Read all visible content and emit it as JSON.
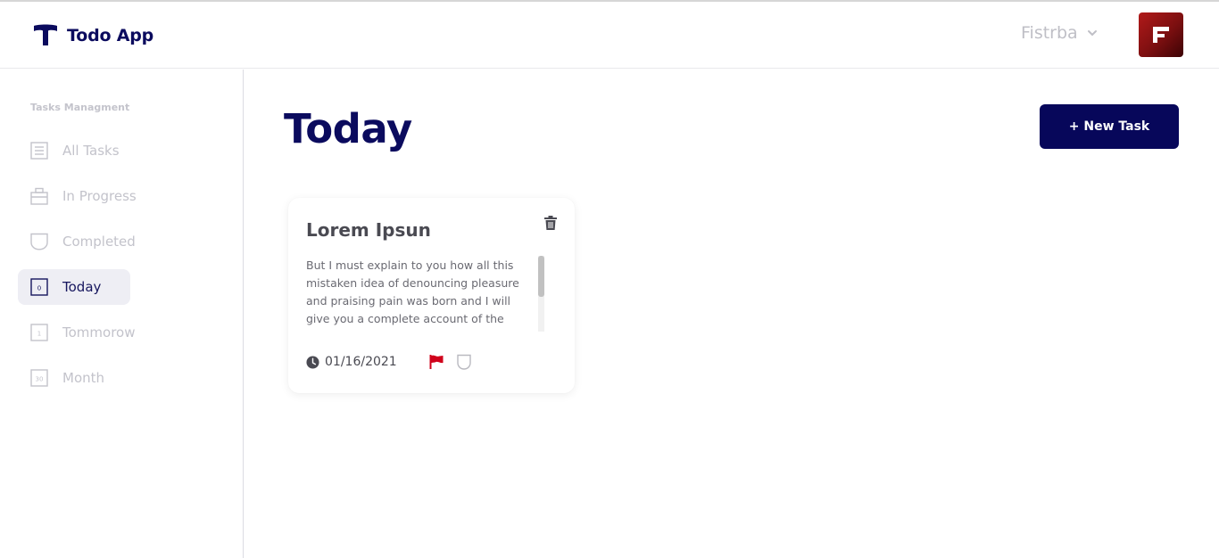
{
  "header": {
    "app_name": "Todo App",
    "user_name": "Fistrba"
  },
  "sidebar": {
    "heading": "Tasks Managment",
    "items": [
      {
        "label": "All Tasks",
        "icon": "list-icon"
      },
      {
        "label": "In Progress",
        "icon": "briefcase-icon"
      },
      {
        "label": "Completed",
        "icon": "shield-icon"
      },
      {
        "label": "Today",
        "icon": "calendar-icon",
        "badge": "0",
        "active": true
      },
      {
        "label": "Tommorow",
        "icon": "calendar-icon",
        "badge": "1"
      },
      {
        "label": "Month",
        "icon": "calendar-icon",
        "badge": "30"
      }
    ]
  },
  "main": {
    "title": "Today",
    "new_task_label": "+ New Task"
  },
  "tasks": [
    {
      "title": "Lorem Ipsun",
      "description": "But I must explain to you how all this mistaken idea of denouncing pleasure and praising pain was born and I will give you a complete account of the system, and expound the actual teachings",
      "date": "01/16/2021",
      "flag_color": "#d0021b"
    }
  ],
  "colors": {
    "brand": "#0b0b5e",
    "button": "#07075a",
    "muted": "#c3c3cb",
    "avatar": "#8b1114"
  }
}
